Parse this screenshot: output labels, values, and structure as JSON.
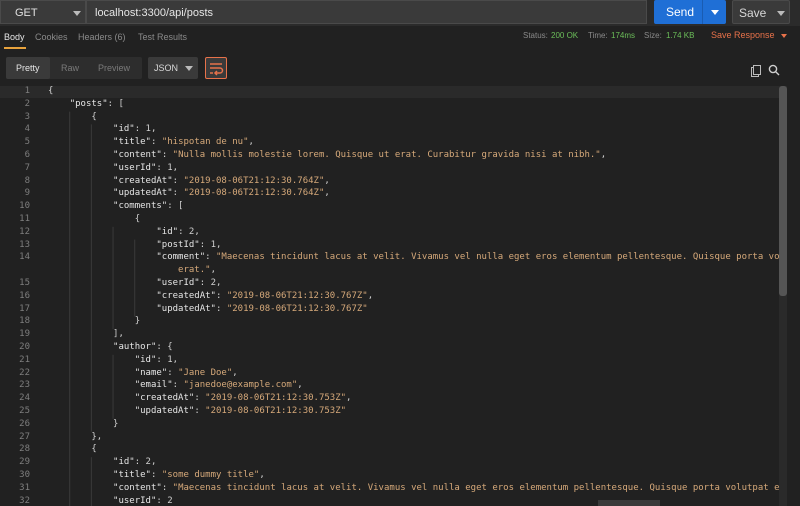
{
  "request": {
    "method": "GET",
    "url": "localhost:3300/api/posts",
    "send_label": "Send",
    "save_label": "Save"
  },
  "response_tabs": [
    {
      "label": "Body"
    },
    {
      "label": "Cookies"
    },
    {
      "label": "Headers (6)"
    },
    {
      "label": "Test Results"
    }
  ],
  "status_bar": {
    "status_label": "Status:",
    "status_value": "200 OK",
    "time_label": "Time:",
    "time_value": "174ms",
    "size_label": "Size:",
    "size_value": "1.74 KB",
    "save_response": "Save Response"
  },
  "toolbar": {
    "view_modes": [
      "Pretty",
      "Raw",
      "Preview"
    ],
    "format": "JSON"
  },
  "icons": {
    "wrap": "wrap-lines-icon",
    "copy": "copy-icon",
    "search": "search-icon"
  },
  "colors": {
    "accent_send": "#1f6fd6",
    "accent_orange": "#e8724a",
    "status_ok": "#6cbf5a"
  },
  "code": {
    "lines": [
      {
        "n": "1",
        "text": "{"
      },
      {
        "n": "2",
        "text": "    \"posts\": ["
      },
      {
        "n": "3",
        "text": "        {"
      },
      {
        "n": "4",
        "text": "            \"id\": 1,"
      },
      {
        "n": "5",
        "text": "            \"title\": \"hispotan de nu\","
      },
      {
        "n": "6",
        "text": "            \"content\": \"Nulla mollis molestie lorem. Quisque ut erat. Curabitur gravida nisi at nibh.\","
      },
      {
        "n": "7",
        "text": "            \"userId\": 1,"
      },
      {
        "n": "8",
        "text": "            \"createdAt\": \"2019-08-06T21:12:30.764Z\","
      },
      {
        "n": "9",
        "text": "            \"updatedAt\": \"2019-08-06T21:12:30.764Z\","
      },
      {
        "n": "10",
        "text": "            \"comments\": ["
      },
      {
        "n": "11",
        "text": "                {"
      },
      {
        "n": "12",
        "text": "                    \"id\": 2,"
      },
      {
        "n": "13",
        "text": "                    \"postId\": 1,"
      },
      {
        "n": "14",
        "text": "                    \"comment\": \"Maecenas tincidunt lacus at velit. Vivamus vel nulla eget eros elementum pellentesque. Quisque porta volutpat"
      },
      {
        "n": "",
        "text": "                        erat.\","
      },
      {
        "n": "15",
        "text": "                    \"userId\": 2,"
      },
      {
        "n": "16",
        "text": "                    \"createdAt\": \"2019-08-06T21:12:30.767Z\","
      },
      {
        "n": "17",
        "text": "                    \"updatedAt\": \"2019-08-06T21:12:30.767Z\""
      },
      {
        "n": "18",
        "text": "                }"
      },
      {
        "n": "19",
        "text": "            ],"
      },
      {
        "n": "20",
        "text": "            \"author\": {"
      },
      {
        "n": "21",
        "text": "                \"id\": 1,"
      },
      {
        "n": "22",
        "text": "                \"name\": \"Jane Doe\","
      },
      {
        "n": "23",
        "text": "                \"email\": \"janedoe@example.com\","
      },
      {
        "n": "24",
        "text": "                \"createdAt\": \"2019-08-06T21:12:30.753Z\","
      },
      {
        "n": "25",
        "text": "                \"updatedAt\": \"2019-08-06T21:12:30.753Z\""
      },
      {
        "n": "26",
        "text": "            }"
      },
      {
        "n": "27",
        "text": "        },"
      },
      {
        "n": "28",
        "text": "        {"
      },
      {
        "n": "29",
        "text": "            \"id\": 2,"
      },
      {
        "n": "30",
        "text": "            \"title\": \"some dummy title\","
      },
      {
        "n": "31",
        "text": "            \"content\": \"Maecenas tincidunt lacus at velit. Vivamus vel nulla eget eros elementum pellentesque. Quisque porta volutpat erat.\","
      },
      {
        "n": "32",
        "text": "            \"userId\": 2"
      }
    ]
  }
}
